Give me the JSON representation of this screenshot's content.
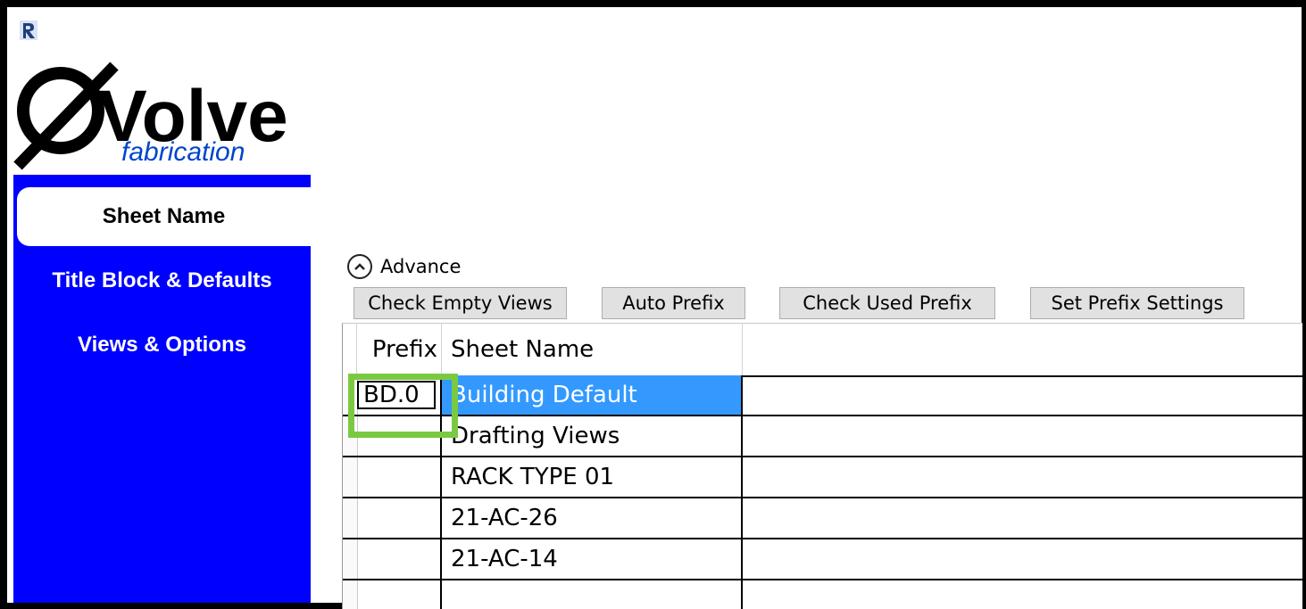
{
  "app": {
    "icon_name": "revit-r-icon",
    "logo": {
      "wordmark": "Volve",
      "subtitle": "fabrication",
      "accent_color": "#0044cc"
    }
  },
  "sidebar": {
    "background": "#0000ff",
    "items": [
      {
        "label": "Sheet Name",
        "active": true
      },
      {
        "label": "Title Block & Defaults",
        "active": false
      },
      {
        "label": "Views & Options",
        "active": false
      }
    ]
  },
  "advance": {
    "icon_name": "chevron-up-circle-icon",
    "label": "Advance"
  },
  "toolbar": {
    "check_empty_views": "Check Empty Views",
    "auto_prefix": "Auto Prefix",
    "check_used_prefix": "Check Used Prefix",
    "set_prefix_settings": "Set Prefix Settings"
  },
  "grid": {
    "columns": [
      "Prefix",
      "Sheet Name"
    ],
    "selection_color": "#3399ff",
    "highlight_color": "#7ac943",
    "rows": [
      {
        "prefix": "BD.0",
        "sheet_name": "Building Default",
        "selected": true,
        "editing": true
      },
      {
        "prefix": "",
        "sheet_name": "Drafting Views"
      },
      {
        "prefix": "",
        "sheet_name": "RACK TYPE 01"
      },
      {
        "prefix": "",
        "sheet_name": "21-AC-26"
      },
      {
        "prefix": "",
        "sheet_name": "21-AC-14"
      }
    ]
  }
}
